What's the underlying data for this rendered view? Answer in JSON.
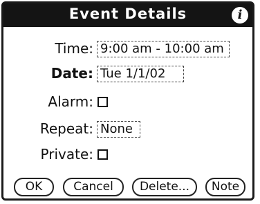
{
  "title": "Event Details",
  "icons": {
    "info": "info-icon"
  },
  "fields": {
    "time": {
      "label": "Time:",
      "value": "9:00 am - 10:00 am"
    },
    "date": {
      "label": "Date:",
      "value": "Tue 1/1/02"
    },
    "alarm": {
      "label": "Alarm:",
      "checked": false
    },
    "repeat": {
      "label": "Repeat:",
      "value": "None"
    },
    "private": {
      "label": "Private:",
      "checked": false
    }
  },
  "buttons": {
    "ok": "OK",
    "cancel": "Cancel",
    "delete": "Delete...",
    "note": "Note"
  }
}
